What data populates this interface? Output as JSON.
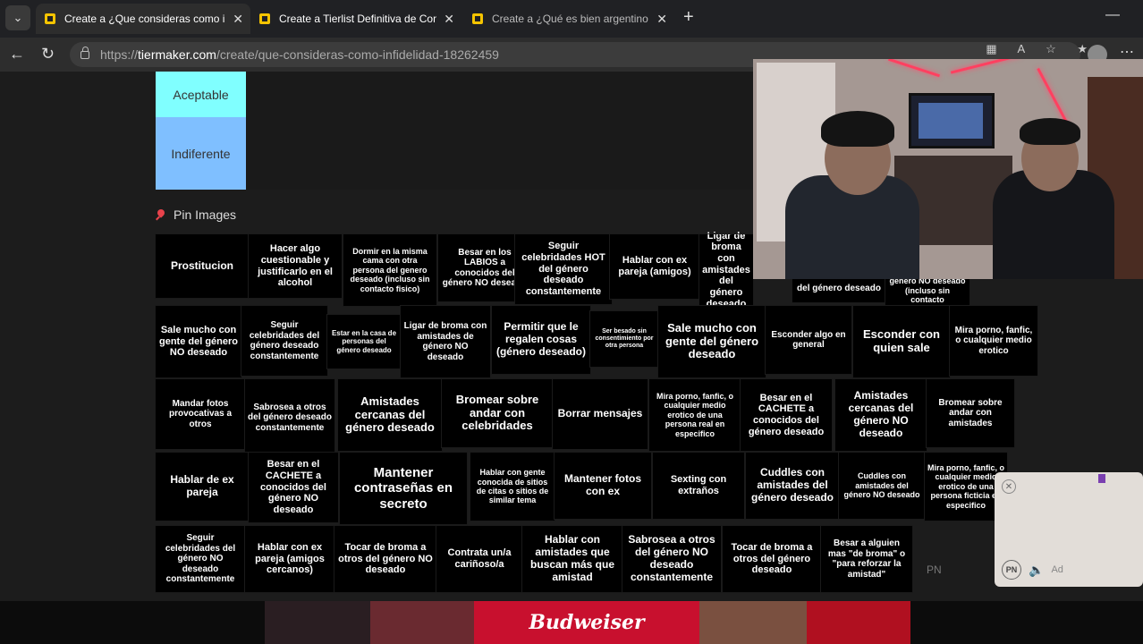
{
  "browser": {
    "tabs": [
      {
        "title": "Create a ¿Que consideras como infidelidad?",
        "active": true
      },
      {
        "title": "Create a Tierlist Definitiva de Comida",
        "active": true
      },
      {
        "title": "Create a ¿Qué es bien argentino y qué no?",
        "active": false
      }
    ],
    "url_prefix": "https://",
    "url_domain": "tiermaker.com",
    "url_path": "/create/que-consideras-como-infidelidad-18262459"
  },
  "tiers": [
    {
      "label": "Aceptable",
      "color": "#80ffff"
    },
    {
      "label": "Indiferente",
      "color": "#7fbfff"
    }
  ],
  "pin_images_label": "Pin Images",
  "items": [
    "Prostitucion",
    "Hacer algo cuestionable y justificarlo en el alcohol",
    "Dormir en la misma cama con otra persona del genero deseado (incluso sin contacto fisico)",
    "Besar en los LABIOS a conocidos del género NO deseado",
    "Seguir celebridades HOT del género deseado constantemente",
    "Hablar con ex pareja (amigos)",
    "Ligar de broma con amistades del género deseado",
    "Sale mucho con gente del género NO deseado",
    "Seguir celebridades del género deseado constantemente",
    "Estar en la casa de personas del género deseado",
    "Ligar de broma con amistades de género NO deseado",
    "Permitir que le regalen cosas (género deseado)",
    "Ser besado sin consentimiento por otra persona",
    "Sale mucho con gente del género deseado",
    "Esconder algo en general",
    "Esconder con quien sale",
    "Mira porno, fanfic, o cualquier medio erotico",
    "Mandar fotos provocativas a otros",
    "Sabrosea a otros del género deseado constantemente",
    "Amistades cercanas del género deseado",
    "Bromear sobre andar con celebridades",
    "Borrar mensajes",
    "Mira porno, fanfic, o cualquier medio erotico de una persona real en especifico",
    "Besar en el CACHETE a conocidos del género deseado",
    "Amistades cercanas del género NO deseado",
    "Bromear sobre andar con amistades",
    "Hablar de ex pareja",
    "Besar en el CACHETE a conocidos del género NO deseado",
    "Mantener contraseñas en secreto",
    "Hablar con gente conocida de sitios de citas o sitios de similar tema",
    "Mantener fotos con ex",
    "Sexting con extraños",
    "Cuddles con amistades del género deseado",
    "Cuddles con amistades del género NO deseado",
    "Mira porno, fanfic, o cualquier medio erotico de una persona ficticia en especifico",
    "Seguir celebridades del género NO deseado constantemente",
    "Hablar con ex pareja (amigos cercanos)",
    "Tocar de broma a otros del género NO deseado",
    "Contrata un/a cariñoso/a",
    "Hablar con amistades que buscan más que amistad",
    "Sabrosea a otros del género NO deseado constantemente",
    "Tocar de broma a otros del género deseado",
    "Besar a alguien mas \"de broma\" o \"para reforzar la amistad\"",
    "del género deseado",
    "género NO deseado (incluso sin contacto"
  ],
  "ads": {
    "brand": "Budweiser",
    "pip_label": "Ad",
    "pip_badge": "PN",
    "footer_badge": "PN"
  },
  "icons": {
    "tab_menu": "chevron-down-icon",
    "back": "arrow-left-icon",
    "reload": "reload-icon",
    "new_tab": "plus-icon",
    "minimize": "minus-icon",
    "menu": "ellipsis-icon"
  }
}
